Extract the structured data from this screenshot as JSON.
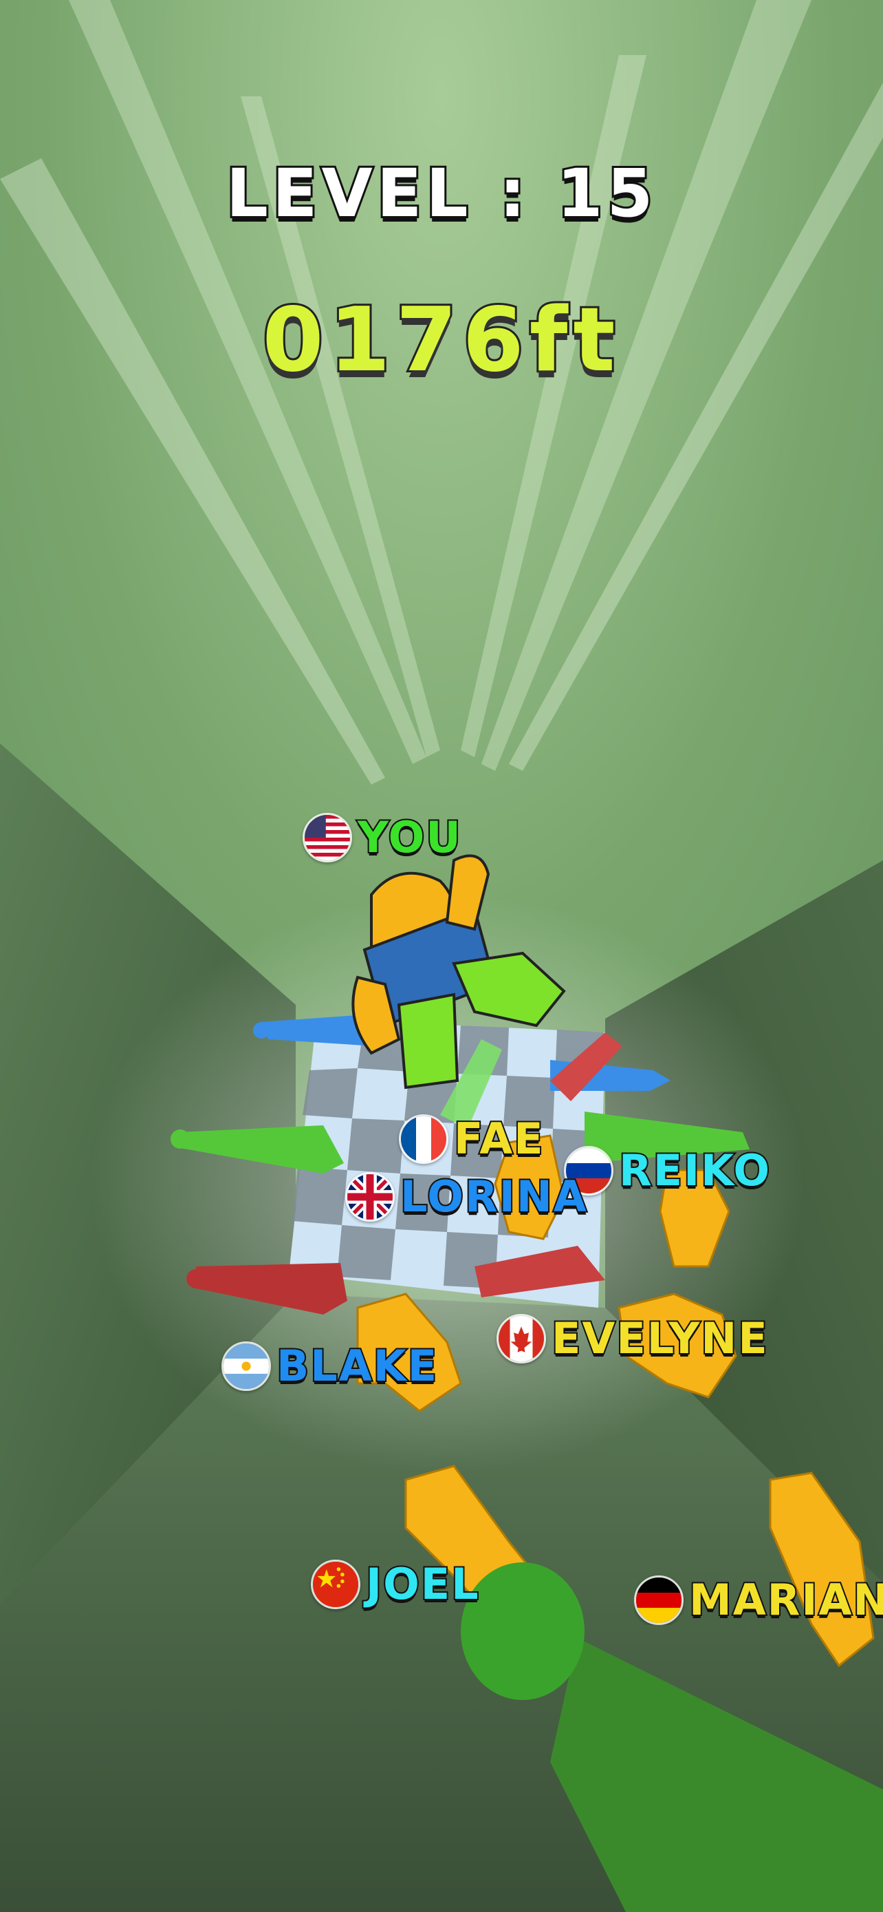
{
  "hud": {
    "level_text": "LEVEL : 15",
    "distance_text": "0176ft"
  },
  "players": [
    {
      "name": "YOU",
      "flag": "usa-flag-icon",
      "color": "#3be22a"
    },
    {
      "name": "FAE",
      "flag": "france-flag-icon",
      "color": "#f3e02a"
    },
    {
      "name": "REIKO",
      "flag": "russia-flag-icon",
      "color": "#2fe6f2"
    },
    {
      "name": "LORINA",
      "flag": "uk-flag-icon",
      "color": "#1f8cf2"
    },
    {
      "name": "EVELYNE",
      "flag": "canada-flag-icon",
      "color": "#f3e02a"
    },
    {
      "name": "BLAKE",
      "flag": "argentina-flag-icon",
      "color": "#1f8cf2"
    },
    {
      "name": "JOEL",
      "flag": "china-flag-icon",
      "color": "#2fe6f2"
    },
    {
      "name": "MARIANI",
      "flag": "germany-flag-icon",
      "color": "#f3e02a"
    }
  ],
  "colors": {
    "sky_top": "#9ec48f",
    "sky_mid": "#739f69",
    "wall_dark": "#3f5a3c",
    "character": "#f6b418",
    "accent_green": "#3aa32c"
  }
}
